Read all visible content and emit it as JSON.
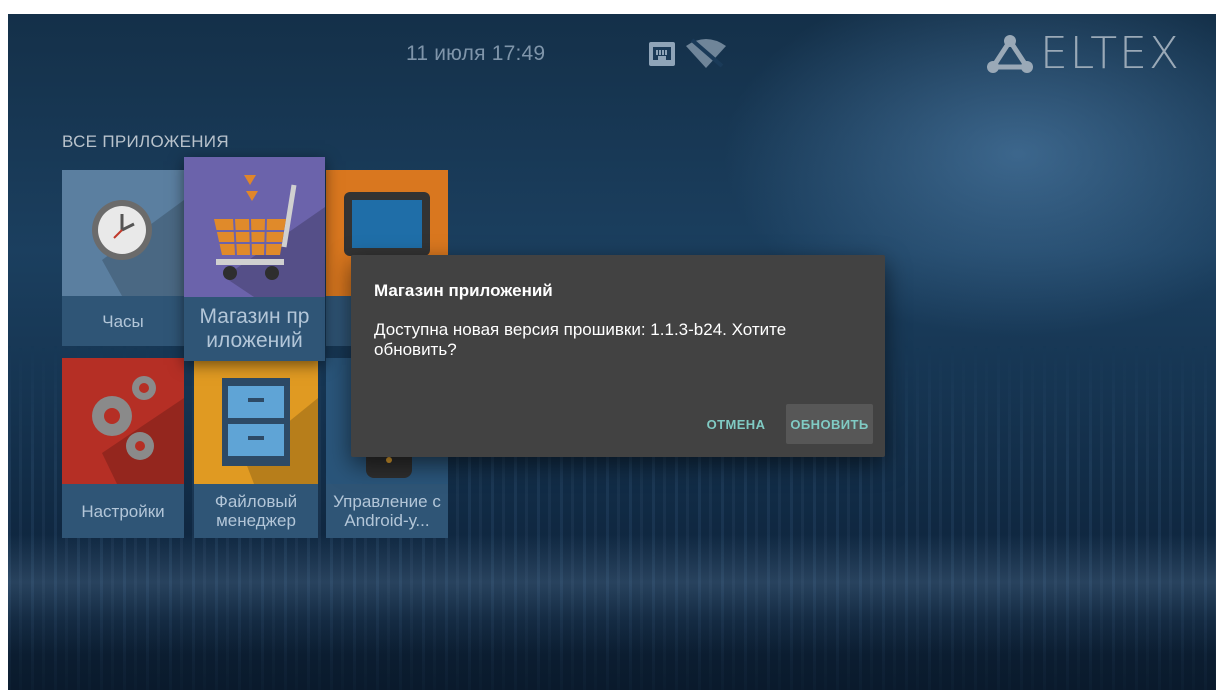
{
  "status_bar": {
    "datetime": "11 июля 17:49",
    "ethernet_icon": "ethernet-icon",
    "wifi_icon": "wifi-off-icon",
    "logo_text": "ELTEX"
  },
  "section_title": "ВСЕ ПРИЛОЖЕНИЯ",
  "apps": [
    {
      "label": "Часы",
      "icon": "clock-icon",
      "color": "#5d8bb0"
    },
    {
      "label": "Магазин пр иложений",
      "icon": "shopping-cart-icon",
      "color": "#7a72b5",
      "focused": true
    },
    {
      "label": "",
      "icon": "tablet-icon",
      "color": "#e8862a"
    },
    {
      "label": "Настройки",
      "icon": "gears-icon",
      "color": "#c0392b"
    },
    {
      "label": "Файловый менеджер",
      "icon": "file-cabinet-icon",
      "color": "#e6a02a"
    },
    {
      "label": "Управление с Android-у...",
      "icon": "remote-icon",
      "color": "#2c5a80"
    }
  ],
  "dialog": {
    "title": "Магазин приложений",
    "message": "Доступна новая версия прошивки: 1.1.3-b24. Хотите обновить?",
    "cancel_label": "ОТМЕНА",
    "update_label": "ОБНОВИТЬ",
    "accent_color": "#80cbc4"
  }
}
